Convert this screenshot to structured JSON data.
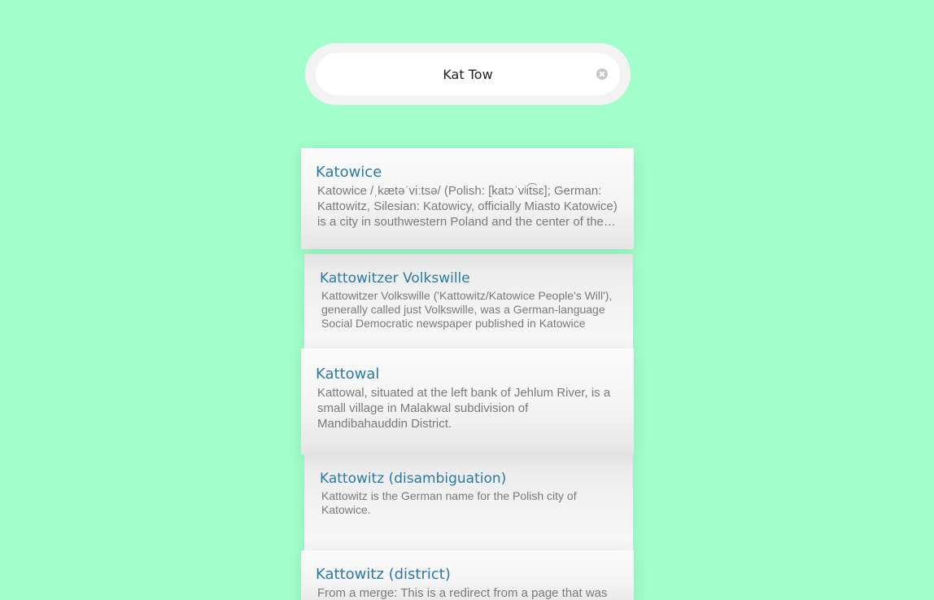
{
  "search": {
    "value": "Kat Tow",
    "clear_icon": "clear-circle-icon"
  },
  "results": [
    {
      "title": "Katowice",
      "snippet": "Katowice /ˌkætəˈviːtsə/ (Polish: [katɔˈvʲit͡sɛ]; German: Kattowitz, Silesian: Katowicy, officially Miasto Katowice) is a city in southwestern Poland and the center of the Silesian Voivodeship"
    },
    {
      "title": "Kattowitzer Volkswille",
      "snippet": "Kattowitzer Volkswille ('Kattowitz/Katowice People's Will'), generally called just Volkswille, was a German-language Social Democratic newspaper published in Katowice"
    },
    {
      "title": "Kattowal",
      "snippet": "Kattowal, situated at the left bank of Jehlum River, is a small village in Malakwal subdivision of Mandibahauddin District."
    },
    {
      "title": "Kattowitz (disambiguation)",
      "snippet": "Kattowitz is the German name for the Polish city of Katowice."
    },
    {
      "title": "Kattowitz (district)",
      "snippet": "From a merge: This is a redirect from a page that was merged into another page"
    }
  ]
}
